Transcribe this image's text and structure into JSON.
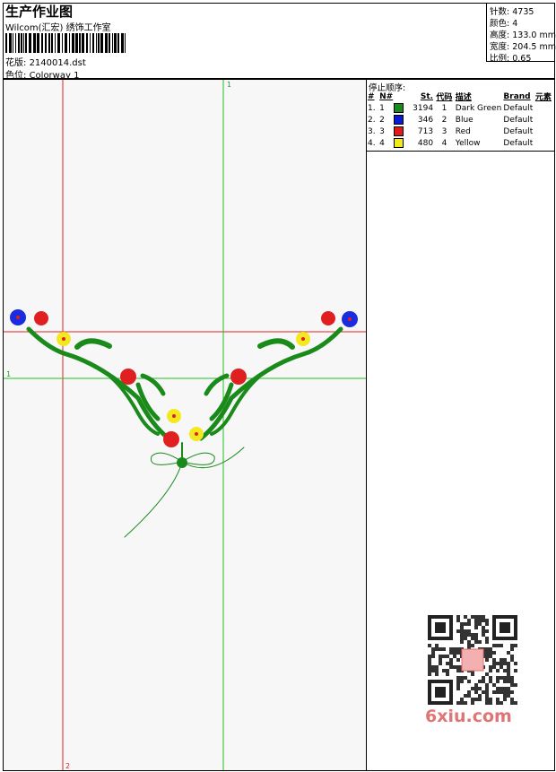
{
  "header": {
    "title": "生产作业图",
    "company": "Wilcom(汇宏) 绣饰工作室",
    "design_label": "花版:",
    "design_value": "2140014.dst",
    "colorway_label": "色位:",
    "colorway_value": "Colorway 1"
  },
  "stats": [
    {
      "label": "针数:",
      "value": "4735"
    },
    {
      "label": "颜色:",
      "value": "4"
    },
    {
      "label": "高度:",
      "value": "133.0 mm"
    },
    {
      "label": "宽度:",
      "value": "204.5 mm"
    },
    {
      "label": "比例:",
      "value": "0.65"
    }
  ],
  "canvas": {
    "guide_top_label": "1",
    "guide_left_label": "1",
    "guide_bottom_label": "2"
  },
  "stop_sequence": {
    "label": "停止顺序:",
    "columns": [
      "#",
      "N#",
      "St.",
      "代码",
      "描述",
      "Brand",
      "元素"
    ],
    "rows": [
      {
        "num": "1.",
        "n": "1",
        "color": "#1a8a1a",
        "st": "3194",
        "code": "1",
        "desc": "Dark Green",
        "brand": "Default"
      },
      {
        "num": "2.",
        "n": "2",
        "color": "#0a18d8",
        "st": "346",
        "code": "2",
        "desc": "Blue",
        "brand": "Default"
      },
      {
        "num": "3.",
        "n": "3",
        "color": "#e01a1a",
        "st": "713",
        "code": "3",
        "desc": "Red",
        "brand": "Default"
      },
      {
        "num": "4.",
        "n": "4",
        "color": "#f2e81a",
        "st": "480",
        "code": "4",
        "desc": "Yellow",
        "brand": "Default"
      }
    ]
  },
  "watermark": {
    "site": "6xiu.com"
  }
}
